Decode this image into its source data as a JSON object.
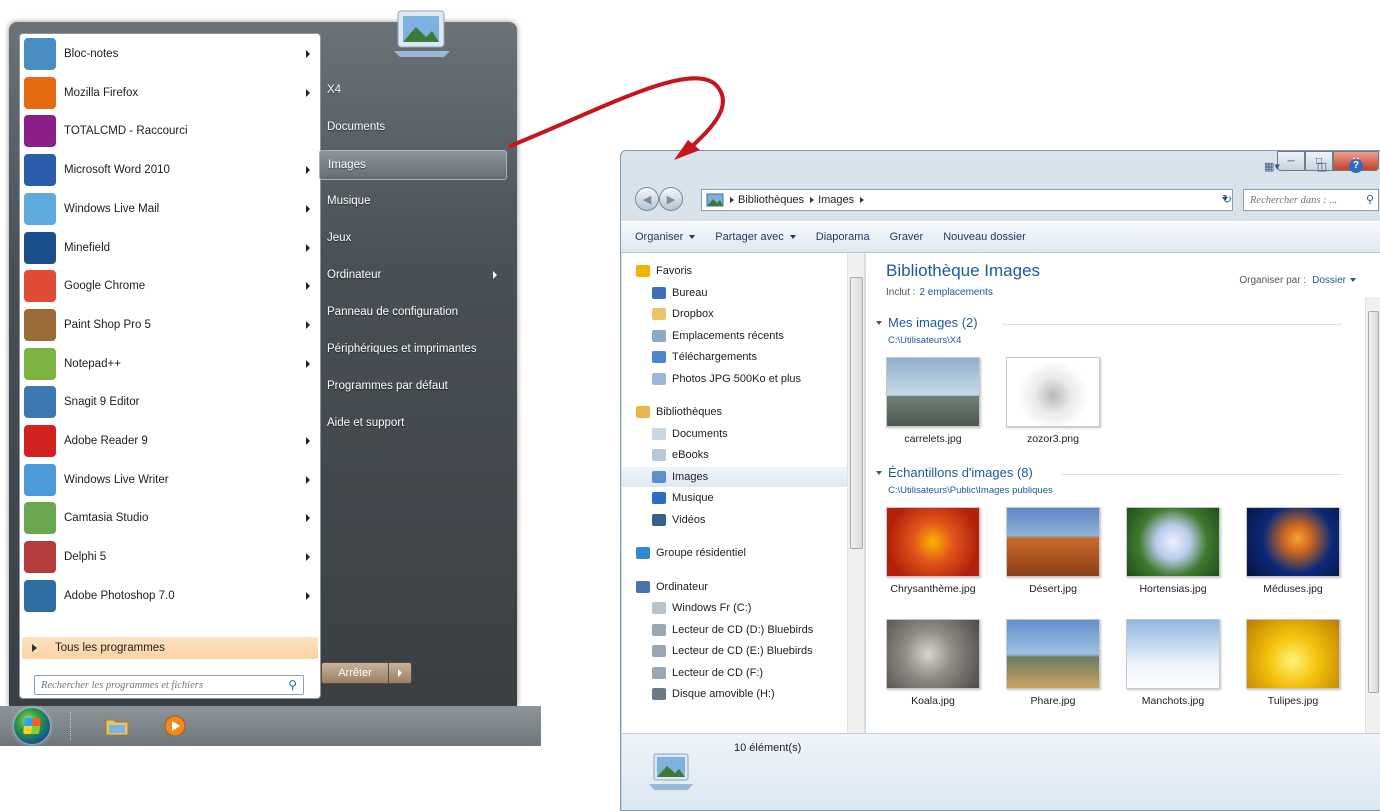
{
  "start_menu": {
    "programs": [
      {
        "label": "Bloc-notes",
        "icon": "notepad-icon",
        "color": "#4a8fc4",
        "arrow": true
      },
      {
        "label": "Mozilla Firefox",
        "icon": "firefox-icon",
        "color": "#e66a12",
        "arrow": true
      },
      {
        "label": "TOTALCMD - Raccourci",
        "icon": "floppy-icon",
        "color": "#8b1e87",
        "arrow": false
      },
      {
        "label": "Microsoft Word 2010",
        "icon": "word-icon",
        "color": "#2a5dab",
        "arrow": true
      },
      {
        "label": "Windows Live Mail",
        "icon": "mail-icon",
        "color": "#5eaadd",
        "arrow": true
      },
      {
        "label": "Minefield",
        "icon": "minefield-icon",
        "color": "#1b4e8c",
        "arrow": true
      },
      {
        "label": "Google Chrome",
        "icon": "chrome-icon",
        "color": "#e04b36",
        "arrow": true
      },
      {
        "label": "Paint Shop Pro 5",
        "icon": "palette-icon",
        "color": "#9c6b3a",
        "arrow": true
      },
      {
        "label": "Notepad++",
        "icon": "notepadpp-icon",
        "color": "#7cb342",
        "arrow": true
      },
      {
        "label": "Snagit 9 Editor",
        "icon": "snagit-icon",
        "color": "#3c78b4",
        "arrow": false
      },
      {
        "label": "Adobe Reader 9",
        "icon": "pdf-icon",
        "color": "#d2221d",
        "arrow": true
      },
      {
        "label": "Windows Live Writer",
        "icon": "writer-icon",
        "color": "#4b9bd8",
        "arrow": true
      },
      {
        "label": "Camtasia Studio",
        "icon": "camtasia-icon",
        "color": "#6aa84f",
        "arrow": true
      },
      {
        "label": "Delphi 5",
        "icon": "delphi-icon",
        "color": "#b43c3c",
        "arrow": true
      },
      {
        "label": "Adobe Photoshop 7.0",
        "icon": "photoshop-icon",
        "color": "#2e6da4",
        "arrow": true
      }
    ],
    "all_programs": "Tous les programmes",
    "search_placeholder": "Rechercher les programmes et fichiers",
    "right_items": [
      {
        "label": "X4",
        "arrow": false,
        "hover": false
      },
      {
        "label": "Documents",
        "arrow": false,
        "hover": false
      },
      {
        "label": "Images",
        "arrow": false,
        "hover": true
      },
      {
        "label": "Musique",
        "arrow": false,
        "hover": false
      },
      {
        "label": "Jeux",
        "arrow": false,
        "hover": false
      },
      {
        "label": "Ordinateur",
        "arrow": true,
        "hover": false
      },
      {
        "label": "Panneau de configuration",
        "arrow": false,
        "hover": false
      },
      {
        "label": "Périphériques et imprimantes",
        "arrow": false,
        "hover": false
      },
      {
        "label": "Programmes par défaut",
        "arrow": false,
        "hover": false
      },
      {
        "label": "Aide et support",
        "arrow": false,
        "hover": false
      }
    ],
    "shutdown": "Arrêter"
  },
  "explorer": {
    "breadcrumb": [
      "Bibliothèques",
      "Images"
    ],
    "search_placeholder": "Rechercher dans : ...",
    "commands": [
      {
        "label": "Organiser",
        "dropdown": true
      },
      {
        "label": "Partager avec",
        "dropdown": true
      },
      {
        "label": "Diaporama",
        "dropdown": false
      },
      {
        "label": "Graver",
        "dropdown": false
      },
      {
        "label": "Nouveau dossier",
        "dropdown": false
      }
    ],
    "nav": [
      {
        "label": "Favoris",
        "icon": "star-icon",
        "color": "#f0b400",
        "indent": 0,
        "gap": 0
      },
      {
        "label": "Bureau",
        "icon": "desktop-icon",
        "color": "#3b6fb6",
        "indent": 1,
        "gap": 0
      },
      {
        "label": "Dropbox",
        "icon": "dropbox-icon",
        "color": "#e9c46a",
        "indent": 1,
        "gap": 0
      },
      {
        "label": "Emplacements récents",
        "icon": "recent-icon",
        "color": "#8aa7c8",
        "indent": 1,
        "gap": 0
      },
      {
        "label": "Téléchargements",
        "icon": "download-icon",
        "color": "#4a86c8",
        "indent": 1,
        "gap": 0
      },
      {
        "label": "Photos JPG 500Ko et plus",
        "icon": "search-folder-icon",
        "color": "#9db6d6",
        "indent": 1,
        "gap": 0
      },
      {
        "label": "Bibliothèques",
        "icon": "library-icon",
        "color": "#e6b84a",
        "indent": 0,
        "gap": 1
      },
      {
        "label": "Documents",
        "icon": "documents-icon",
        "color": "#c9d6e3",
        "indent": 1,
        "gap": 0
      },
      {
        "label": "eBooks",
        "icon": "ebooks-icon",
        "color": "#b9c8d8",
        "indent": 1,
        "gap": 0
      },
      {
        "label": "Images",
        "icon": "images-icon",
        "color": "#5d8fc9",
        "indent": 1,
        "gap": 0,
        "selected": true
      },
      {
        "label": "Musique",
        "icon": "music-icon",
        "color": "#2f6cc0",
        "indent": 1,
        "gap": 0
      },
      {
        "label": "Vidéos",
        "icon": "video-icon",
        "color": "#3a5f8a",
        "indent": 1,
        "gap": 0
      },
      {
        "label": "Groupe résidentiel",
        "icon": "homegroup-icon",
        "color": "#2f8ad0",
        "indent": 0,
        "gap": 1
      },
      {
        "label": "Ordinateur",
        "icon": "computer-icon",
        "color": "#4873a8",
        "indent": 0,
        "gap": 1
      },
      {
        "label": "Windows Fr (C:)",
        "icon": "drive-icon",
        "color": "#b8c2cc",
        "indent": 1,
        "gap": 0
      },
      {
        "label": "Lecteur de CD (D:) Bluebirds",
        "icon": "cd-drive-icon",
        "color": "#9aa6b2",
        "indent": 1,
        "gap": 0
      },
      {
        "label": "Lecteur de CD (E:) Bluebirds",
        "icon": "cd-drive-icon",
        "color": "#9aa6b2",
        "indent": 1,
        "gap": 0
      },
      {
        "label": "Lecteur de CD (F:)",
        "icon": "cd-drive-icon",
        "color": "#9aa6b2",
        "indent": 1,
        "gap": 0
      },
      {
        "label": "Disque amovible (H:)",
        "icon": "removable-drive-icon",
        "color": "#6c7a88",
        "indent": 1,
        "gap": 0
      }
    ],
    "library_title": "Bibliothèque Images",
    "include_label": "Inclut :",
    "include_link": "2 emplacements",
    "arrange_label": "Organiser par :",
    "arrange_value": "Dossier",
    "groups": [
      {
        "title": "Mes images (2)",
        "path": "C:\\Utilisateurs\\X4",
        "items": [
          {
            "name": "carrelets.jpg",
            "bg": "linear-gradient(#8fb0cf 0%,#c7d8e6 55%,#6f7f73 56%,#4d5a52 100%)"
          },
          {
            "name": "zozor3.png",
            "bg": "radial-gradient(circle at 50% 55%,#b7b7b7 0%,#e9e9e9 30%,#ffffff 60%)"
          }
        ]
      },
      {
        "title": "Échantillons d'images (8)",
        "path": "C:\\Utilisateurs\\Public\\Images publiques",
        "items": [
          {
            "name": "Chrysanthème.jpg",
            "bg": "radial-gradient(circle at 50% 50%,#f7b500 0%,#e2551b 35%,#b3200c 80%)"
          },
          {
            "name": "Désert.jpg",
            "bg": "linear-gradient(#5e88c2 0%,#8fb0d8 40%,#c8692c 45%,#8e3f18 100%)"
          },
          {
            "name": "Hortensias.jpg",
            "bg": "radial-gradient(circle at 50% 50%,#f0f0ff 0%,#b8c9e8 30%,#3e7a2e 60%,#1f4d1a 100%)"
          },
          {
            "name": "Méduses.jpg",
            "bg": "radial-gradient(circle at 55% 45%,#f4a13a 0%,#d46b1c 20%,#0d2a78 55%,#06123d 100%)"
          },
          {
            "name": "Koala.jpg",
            "bg": "radial-gradient(circle at 45% 50%,#d9d4cc 0%,#8f8a84 40%,#4d4a47 100%)"
          },
          {
            "name": "Phare.jpg",
            "bg": "linear-gradient(#5f8fc9 0%,#9cc1e3 50%,#6b7b62 55%,#c9a25e 100%)"
          },
          {
            "name": "Manchots.jpg",
            "bg": "linear-gradient(#8fb5e0 0%,#e7f0fa 60%,#ffffff 100%)"
          },
          {
            "name": "Tulipes.jpg",
            "bg": "radial-gradient(circle at 50% 60%,#fff27a 0%,#f4c20d 40%,#b97d00 100%)"
          }
        ]
      }
    ],
    "item_count": "10 élément(s)"
  }
}
